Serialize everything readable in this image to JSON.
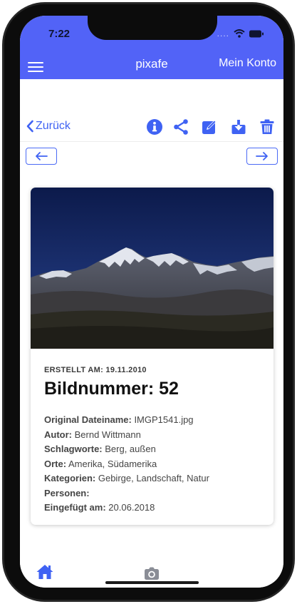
{
  "status_bar": {
    "time": "7:22",
    "signal": "...."
  },
  "app_bar": {
    "title": "pixafe",
    "account_label": "Mein Konto"
  },
  "toolbar": {
    "back_label": "Zurück"
  },
  "image": {
    "created_label": "ERSTELLT AM:",
    "created_value": "19.11.2010",
    "title_prefix": "Bildnummer:",
    "number": "52",
    "fields": [
      {
        "label": "Original Dateiname:",
        "value": "IMGP1541.jpg"
      },
      {
        "label": "Autor:",
        "value": "Bernd Wittmann"
      },
      {
        "label": "Schlagworte:",
        "value": "Berg, außen"
      },
      {
        "label": "Orte:",
        "value": "Amerika, Südamerika"
      },
      {
        "label": "Kategorien:",
        "value": "Gebirge, Landschaft, Natur"
      },
      {
        "label": "Personen:",
        "value": ""
      },
      {
        "label": "Eingefügt am:",
        "value": "20.06.2018"
      }
    ]
  },
  "icons": {
    "menu": "menu-icon",
    "back": "chevron-left-icon",
    "info": "info-icon",
    "share": "share-icon",
    "edit": "edit-icon",
    "download": "download-icon",
    "delete": "trash-icon",
    "prev": "arrow-left-icon",
    "next": "arrow-right-icon",
    "home": "home-icon",
    "camera": "camera-icon"
  },
  "colors": {
    "app_bar": "#5263f7",
    "accent": "#3f62f3"
  }
}
